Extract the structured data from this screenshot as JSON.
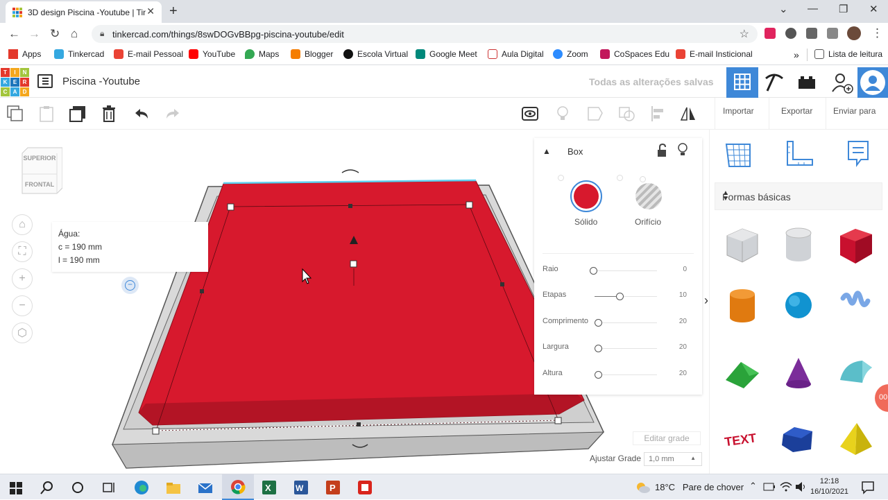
{
  "browser": {
    "tab_title": "3D design Piscina -Youtube | Tin",
    "url": "tinkercad.com/things/8swDOGvBBpg-piscina-youtube/edit",
    "bookmarks": [
      "Apps",
      "Tinkercad",
      "E-mail Pessoal",
      "YouTube",
      "Maps",
      "Blogger",
      "Escola Virtual",
      "Google Meet",
      "Aula Digital",
      "Zoom",
      "CoSpaces Edu",
      "E-mail Insticional"
    ],
    "reading_list": "Lista de leitura",
    "more_bookmarks": "»"
  },
  "app": {
    "logo_letters": [
      "TIN",
      "KER",
      "CAD"
    ],
    "logo_colors": [
      "#e3382b",
      "#f4a71d",
      "#a3c53c",
      "#35a8e0",
      "#1c75bc",
      "#e3382b",
      "#a3c53c",
      "#35a8e0",
      "#f4a71d"
    ],
    "design_title": "Piscina -Youtube",
    "save_status": "Todas as alterações salvas",
    "accent": "#3e88d8"
  },
  "toolbar": {
    "import_label": "Importar",
    "export_label": "Exportar",
    "send_label": "Enviar para"
  },
  "viewcube": {
    "top_label": "SUPERIOR",
    "front_label": "FRONTAL"
  },
  "tooltip": {
    "title": "Água:",
    "length": "c = 190 mm",
    "width": "l = 190 mm"
  },
  "inspector": {
    "shape_name": "Box",
    "solid_label": "Sólido",
    "hole_label": "Orifício",
    "solid_color": "#d7192d",
    "props": [
      {
        "label": "Raio",
        "value": "0",
        "level": 0
      },
      {
        "label": "Etapas",
        "value": "10",
        "level": 0.4
      },
      {
        "label": "Comprimento",
        "value": "20",
        "level": 0.06
      },
      {
        "label": "Largura",
        "value": "20",
        "level": 0.06
      },
      {
        "label": "Altura",
        "value": "20",
        "level": 0.06
      }
    ]
  },
  "shapes_panel": {
    "category": "Formas básicas"
  },
  "grid": {
    "edit_label": "Editar grade",
    "snap_label": "Ajustar Grade",
    "snap_value": "1,0 mm"
  },
  "taskbar": {
    "temperature": "18°C",
    "weather": "Pare de chover",
    "time": "12:18",
    "date": "16/10/2021"
  },
  "model_color": "#d7192d"
}
